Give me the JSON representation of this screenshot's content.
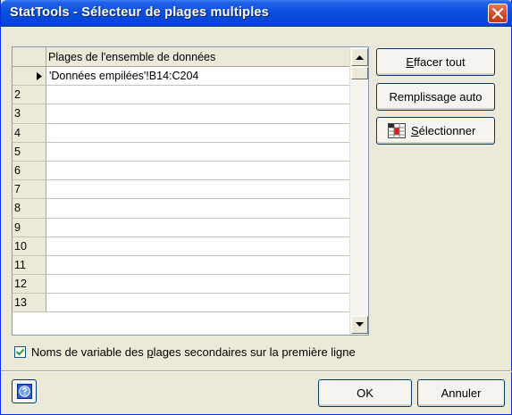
{
  "window": {
    "title": "StatTools - Sélecteur de plages multiples"
  },
  "grid": {
    "column_header": "Plages de l'ensemble de données",
    "rows": [
      {
        "label": "",
        "value": "'Données empilées'!B14:C204",
        "current": true
      },
      {
        "label": "2",
        "value": ""
      },
      {
        "label": "3",
        "value": ""
      },
      {
        "label": "4",
        "value": ""
      },
      {
        "label": "5",
        "value": ""
      },
      {
        "label": "6",
        "value": ""
      },
      {
        "label": "7",
        "value": ""
      },
      {
        "label": "8",
        "value": ""
      },
      {
        "label": "9",
        "value": ""
      },
      {
        "label": "10",
        "value": ""
      },
      {
        "label": "11",
        "value": ""
      },
      {
        "label": "12",
        "value": ""
      },
      {
        "label": "13",
        "value": ""
      }
    ]
  },
  "buttons": {
    "effacer_accel": "E",
    "effacer_rest": "ffacer tout",
    "remplissage_pre": "Remplissa",
    "remplissage_accel": "g",
    "remplissage_rest": "e auto",
    "selectionner_accel": "S",
    "selectionner_rest": "électionner",
    "ok": "OK",
    "annuler": "Annuler"
  },
  "checkbox": {
    "checked": true,
    "label_pre": "Noms de variable des ",
    "label_accel": "p",
    "label_rest": "lages secondaires sur la première ligne"
  },
  "icons": {
    "close": "close-icon",
    "help": "help-icon",
    "select_range": "select-range-icon",
    "row_pointer": "row-pointer-icon"
  }
}
